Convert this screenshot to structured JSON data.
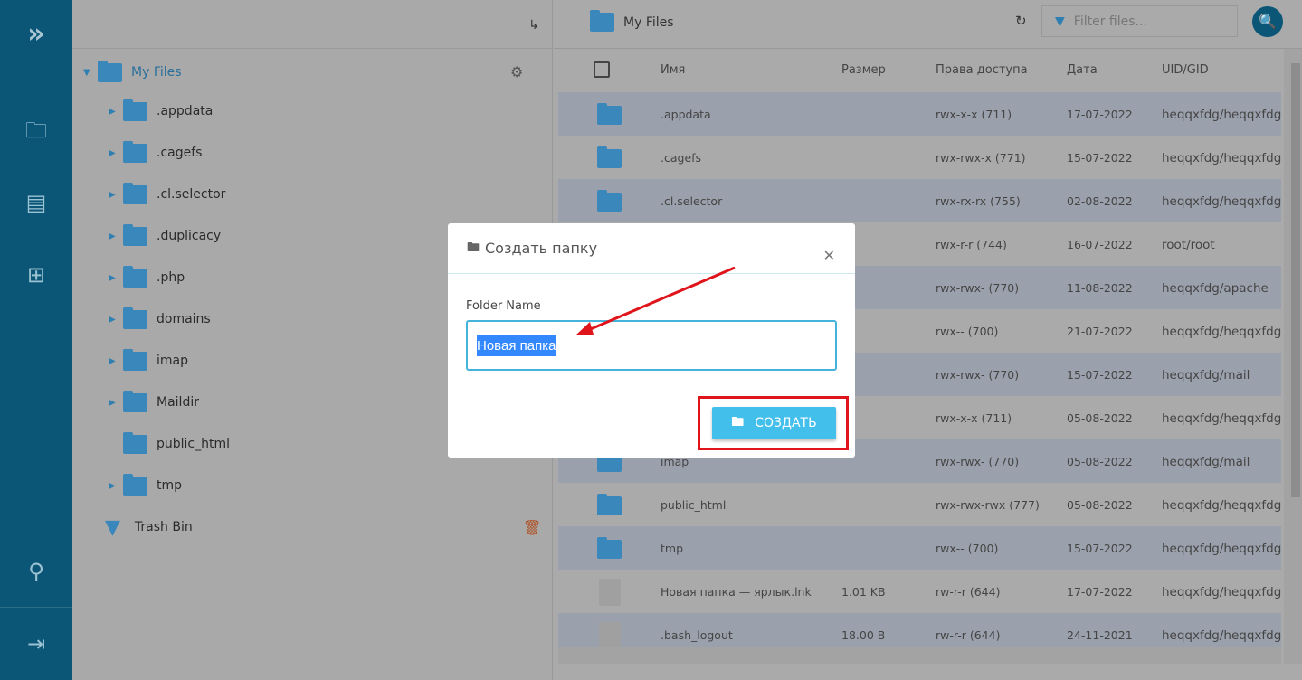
{
  "rail": {
    "icons": [
      "logo-icon",
      "folder-icon",
      "document-icon",
      "plus-square-icon",
      "sliders-icon",
      "logout-icon"
    ]
  },
  "tree": {
    "root": "My Files",
    "items": [
      ".appdata",
      ".cagefs",
      ".cl.selector",
      ".duplicacy",
      ".php",
      "domains",
      "imap",
      "Maildir",
      "public_html",
      "tmp"
    ],
    "trash": "Trash Bin"
  },
  "header": {
    "title": "My Files",
    "filter_placeholder": "Filter files..."
  },
  "table": {
    "columns": [
      "Имя",
      "Размер",
      "Права доступа",
      "Дата",
      "UID/GID"
    ],
    "rows": [
      {
        "type": "folder",
        "name": ".appdata",
        "size": "",
        "perm": "rwx-x-x (711)",
        "date": "17-07-2022",
        "owner": "heqqxfdg/heqqxfdg"
      },
      {
        "type": "folder",
        "name": ".cagefs",
        "size": "",
        "perm": "rwx-rwx-x (771)",
        "date": "15-07-2022",
        "owner": "heqqxfdg/heqqxfdg"
      },
      {
        "type": "folder",
        "name": ".cl.selector",
        "size": "",
        "perm": "rwx-rx-rx (755)",
        "date": "02-08-2022",
        "owner": "heqqxfdg/heqqxfdg"
      },
      {
        "type": "folder",
        "name": "",
        "size": "",
        "perm": "rwx-r-r (744)",
        "date": "16-07-2022",
        "owner": "root/root"
      },
      {
        "type": "folder",
        "name": "",
        "size": "",
        "perm": "rwx-rwx- (770)",
        "date": "11-08-2022",
        "owner": "heqqxfdg/apache"
      },
      {
        "type": "folder",
        "name": "",
        "size": "",
        "perm": "rwx-- (700)",
        "date": "21-07-2022",
        "owner": "heqqxfdg/heqqxfdg"
      },
      {
        "type": "folder",
        "name": "",
        "size": "",
        "perm": "rwx-rwx- (770)",
        "date": "15-07-2022",
        "owner": "heqqxfdg/mail"
      },
      {
        "type": "folder",
        "name": "",
        "size": "",
        "perm": "rwx-x-x (711)",
        "date": "05-08-2022",
        "owner": "heqqxfdg/heqqxfdg"
      },
      {
        "type": "folder",
        "name": "imap",
        "size": "",
        "perm": "rwx-rwx- (770)",
        "date": "05-08-2022",
        "owner": "heqqxfdg/mail"
      },
      {
        "type": "link",
        "name": "public_html",
        "size": "",
        "perm": "rwx-rwx-rwx (777)",
        "date": "05-08-2022",
        "owner": "heqqxfdg/heqqxfdg"
      },
      {
        "type": "folder",
        "name": "tmp",
        "size": "",
        "perm": "rwx-- (700)",
        "date": "15-07-2022",
        "owner": "heqqxfdg/heqqxfdg"
      },
      {
        "type": "file",
        "name": "Новая папка — ярлык.lnk",
        "size": "1.01 KB",
        "perm": "rw-r-r (644)",
        "date": "17-07-2022",
        "owner": "heqqxfdg/heqqxfdg"
      },
      {
        "type": "file",
        "name": ".bash_logout",
        "size": "18.00 B",
        "perm": "rw-r-r (644)",
        "date": "24-11-2021",
        "owner": "heqqxfdg/heqqxfdg"
      }
    ]
  },
  "modal": {
    "title": "Создать папку",
    "label": "Folder Name",
    "value": "Новая папка",
    "create": "СОЗДАТЬ"
  },
  "colors": {
    "accent": "#43bfec",
    "rail": "#0b5677",
    "annotation": "#e0141b"
  }
}
